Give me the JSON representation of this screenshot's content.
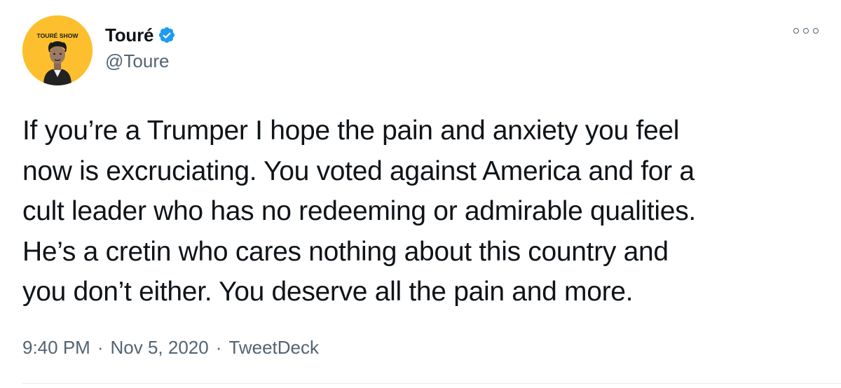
{
  "author": {
    "display_name": "Touré",
    "handle": "@Toure",
    "verified": true,
    "avatar_logo_text": "TOURÉ SHOW",
    "avatar_bg": "#fdbf2d"
  },
  "tweet": {
    "text": "If you’re a Trumper I hope the pain and anxiety you feel\nnow is excruciating. You voted against America and for a\ncult leader who has no redeeming or admirable qualities.\nHe’s a cretin who cares nothing about this country and\nyou don’t either. You deserve all the pain and more."
  },
  "meta": {
    "time": "9:40 PM",
    "date": "Nov 5, 2020",
    "source": "TweetDeck",
    "separator": "·"
  },
  "icons": {
    "verified": "verified-badge-icon",
    "more": "more-options-icon"
  },
  "colors": {
    "verified_blue": "#1d9bf0",
    "secondary_text": "#536471",
    "primary_text": "#0f1419"
  }
}
